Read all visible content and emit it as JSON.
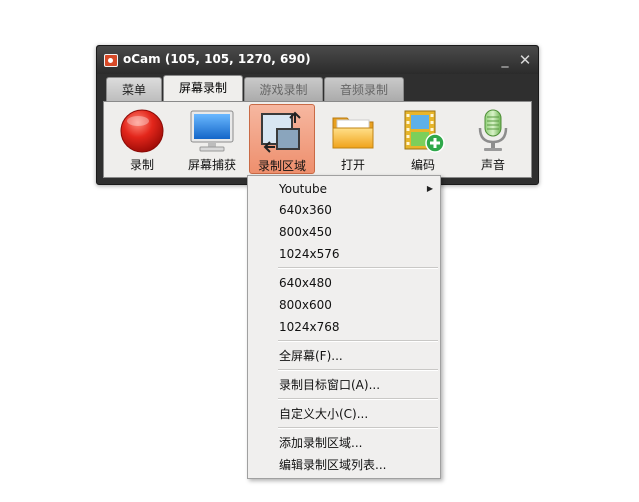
{
  "window": {
    "title": "oCam (105, 105, 1270, 690)",
    "minimize_glyph": "_",
    "close_glyph": "✕"
  },
  "tabs": [
    {
      "label": "菜单",
      "state": "normal"
    },
    {
      "label": "屏幕录制",
      "state": "active"
    },
    {
      "label": "游戏录制",
      "state": "disabled"
    },
    {
      "label": "音频录制",
      "state": "disabled"
    }
  ],
  "toolbar": {
    "items": [
      {
        "label": "录制",
        "icon": "record-icon"
      },
      {
        "label": "屏幕捕获",
        "icon": "monitor-icon"
      },
      {
        "label": "录制区域",
        "icon": "region-icon",
        "selected": true
      },
      {
        "label": "打开",
        "icon": "folder-icon"
      },
      {
        "label": "编码",
        "icon": "film-icon"
      },
      {
        "label": "声音",
        "icon": "microphone-icon"
      }
    ]
  },
  "menu": {
    "items": [
      {
        "label": "Youtube",
        "submenu": true
      },
      {
        "label": "640x360"
      },
      {
        "label": "800x450"
      },
      {
        "label": "1024x576"
      },
      {
        "label": "640x480"
      },
      {
        "label": "800x600"
      },
      {
        "label": "1024x768"
      },
      {
        "label": "全屏幕(F)..."
      },
      {
        "label": "录制目标窗口(A)..."
      },
      {
        "label": "自定义大小(C)..."
      },
      {
        "label": "添加录制区域..."
      },
      {
        "label": "编辑录制区域列表..."
      }
    ]
  },
  "colors": {
    "titlebar": "#2b2b2b",
    "selected_tool": "#ee8f6d",
    "menu_bg": "#f0efee"
  }
}
